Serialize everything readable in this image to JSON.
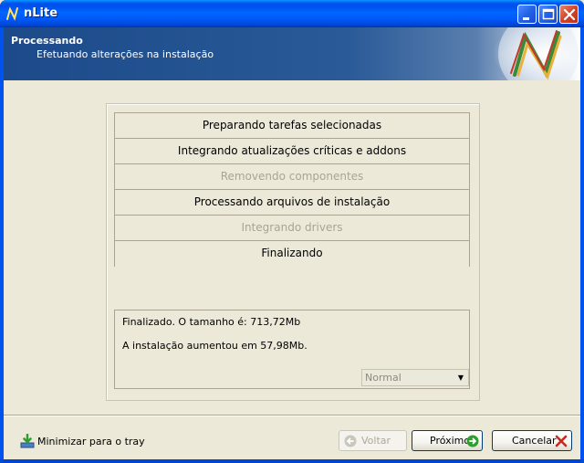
{
  "window": {
    "title": "nLite"
  },
  "banner": {
    "title": "Processando",
    "subtitle": "Efetuando alterações na instalação"
  },
  "steps": [
    {
      "label": "Preparando tarefas selecionadas",
      "state": "done"
    },
    {
      "label": "Integrando atualizações críticas e addons",
      "state": "done"
    },
    {
      "label": "Removendo componentes",
      "state": "skipped"
    },
    {
      "label": "Processando arquivos de instalação",
      "state": "done"
    },
    {
      "label": "Integrando drivers",
      "state": "skipped"
    },
    {
      "label": "Finalizando",
      "state": "done"
    }
  ],
  "log": {
    "line1": "Finalizado. O tamanho é: 713,72Mb",
    "line2": "A instalação aumentou em 57,98Mb."
  },
  "priority": {
    "selected": "Normal"
  },
  "footer": {
    "tray_label": "Minimizar para o tray",
    "back_label": "Voltar",
    "next_label": "Próximo",
    "cancel_label": "Cancelar"
  },
  "colors": {
    "titlebar": "#0053ee",
    "banner": "#1c4a8a",
    "disabled_text": "#a8a595",
    "next_arrow": "#2e9e2e",
    "cancel_x": "#c8281e"
  }
}
